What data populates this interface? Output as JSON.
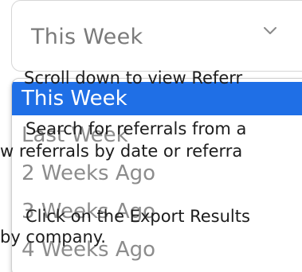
{
  "select": {
    "value": "This Week",
    "chevron_icon": "chevron-down-icon"
  },
  "dropdown": {
    "options": [
      {
        "label": "This Week",
        "selected": true
      },
      {
        "label": "Last Week",
        "selected": false
      },
      {
        "label": "2 Weeks Ago",
        "selected": false
      },
      {
        "label": "3 Weeks Ago",
        "selected": false
      },
      {
        "label": "4 Weeks Ago",
        "selected": false
      }
    ]
  },
  "overlay": {
    "line1": "Scroll down to view Referr",
    "line2": "Search for referrals from a",
    "line3": "w referrals by date or referra",
    "line4": "Click on the Export Results",
    "line5": "by company."
  },
  "colors": {
    "selected_bg": "#1f6fe6",
    "option_text": "#8c8c8c",
    "border": "#d6d6d6"
  }
}
